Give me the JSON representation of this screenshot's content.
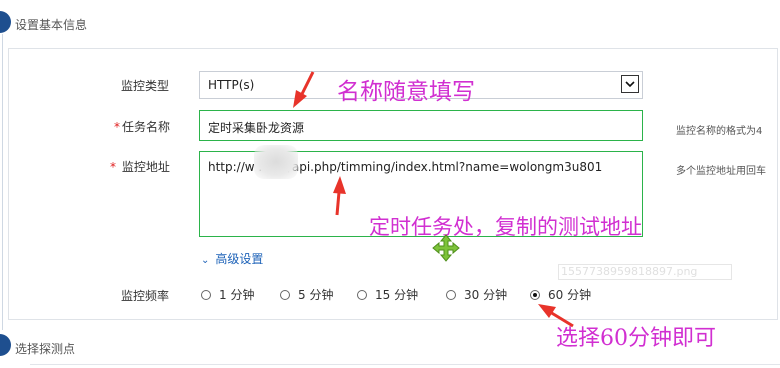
{
  "section1": {
    "title": "设置基本信息"
  },
  "form": {
    "monitor_type": {
      "label": "监控类型",
      "value": "HTTP(s)"
    },
    "task_name": {
      "required_mark": "*",
      "label": "任务名称",
      "value": "定时采集卧龙资源",
      "hint": "监控名称的格式为4"
    },
    "monitor_url": {
      "required_mark": "*",
      "label": "监控地址",
      "value": "http://w        .com/api.php/timming/index.html?name=wolongm3u801",
      "hint": "多个监控地址用回车"
    },
    "advanced": {
      "label": "高级设置"
    },
    "frequency": {
      "label": "监控频率",
      "options": [
        "1 分钟",
        "5 分钟",
        "15 分钟",
        "30 分钟",
        "60 分钟"
      ],
      "selected": "60 分钟"
    },
    "ghost_filename": "1557738959818897.png"
  },
  "section2": {
    "title": "选择探测点"
  },
  "annotations": {
    "name_note": "名称随意填写",
    "url_note": "定时任务处，复制的测试地址",
    "freq_note": "选择60分钟即可"
  },
  "colors": {
    "annotation": "#d12fd1",
    "arrow": "#e8332a",
    "valid_border": "#2bb34a",
    "link": "#1d62b8",
    "step": "#1e4f8f"
  }
}
